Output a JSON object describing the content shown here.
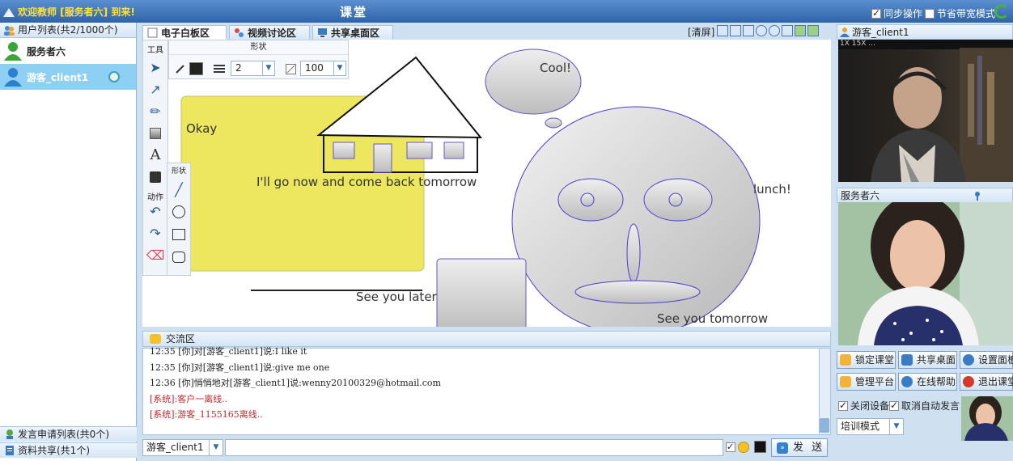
{
  "titlebar": {
    "welcome": "欢迎教师 [服务者六] 到来!",
    "title": "课堂",
    "sync_label": "同步操作",
    "bandwidth_label": "节省带宽模式"
  },
  "users": {
    "header": "用户列表(共2/1000个)",
    "list": [
      {
        "name": "服务者六"
      },
      {
        "name": "游客_client1"
      }
    ],
    "requests_footer": "发言申请列表(共0个)",
    "files_footer": "资料共享(共1个)"
  },
  "tabs": [
    {
      "label": "电子白板区"
    },
    {
      "label": "视频讨论区"
    },
    {
      "label": "共享桌面区"
    }
  ],
  "board_toolbar": {
    "clear_label": "[清屏]"
  },
  "toolbox": {
    "tools_label": "工具",
    "shape_label": "形状",
    "subshape_label": "形状",
    "action_label": "动作",
    "line_width": "2",
    "opacity": "100"
  },
  "whiteboard": {
    "texts": {
      "okay": "Okay",
      "go_now": "I'll go now and come back tomorrow",
      "cool": "Cool!",
      "lunch": "lunch!",
      "see_later": "See you later",
      "see_tomorrow": "See you tomorrow"
    }
  },
  "chat": {
    "header": "交流区",
    "messages": [
      {
        "text": "12:35 [你]对[游客_client1]说:I like it",
        "type": "normal"
      },
      {
        "text": "12:35 [你]对[游客_client1]说:give me one",
        "type": "normal"
      },
      {
        "text": "12:36 [你]悄悄地对[游客_client1]说:wenny20100329@hotmail.com",
        "type": "normal"
      },
      {
        "text": "[系统]:客户一离线..",
        "type": "system"
      },
      {
        "text": "[系统]:游客_1155165离线..",
        "type": "system"
      }
    ],
    "recipient": "游客_client1",
    "input_value": "",
    "send_label": "发 送"
  },
  "video": {
    "client_title": "游客_client1",
    "client_toolbar": "1X  15X  ...",
    "teacher_title": "服务者六"
  },
  "controls": {
    "lock_class": "锁定课堂",
    "share_desktop": "共享桌面",
    "settings_panel": "设置面板",
    "admin_platform": "管理平台",
    "online_help": "在线帮助",
    "exit_class": "退出课堂",
    "close_device": "关闭设备",
    "cancel_auto_speak": "取消自动发言",
    "mode": "培训模式"
  },
  "colors": {
    "sticky_note": "#ece75e",
    "selected_user": "#8ecff4",
    "title_gradient_top": "#5a8fd0",
    "title_gradient_bottom": "#2f63a8",
    "welcome_text": "#ffe23a",
    "system_message": "#c0282d"
  }
}
